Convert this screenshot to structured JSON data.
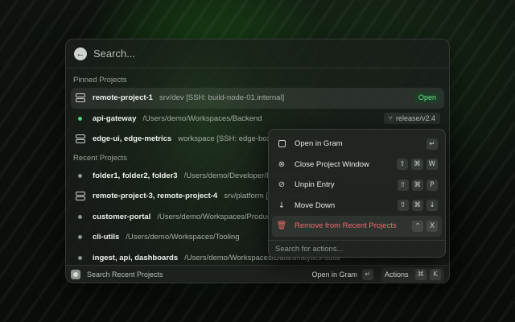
{
  "search": {
    "placeholder": "Search..."
  },
  "sections": {
    "pinned": "Pinned Projects",
    "recent": "Recent Projects"
  },
  "pinned": [
    {
      "icon": "server-icon",
      "name": "remote-project-1",
      "path": "srv/dev [SSH: build-node-01.internal]",
      "badge": "Open"
    },
    {
      "icon": "status-dot-icon",
      "name": "api-gateway",
      "path": "/Users/demo/Workspaces/Backend",
      "branch": "release/v2.4"
    },
    {
      "icon": "server-icon",
      "name": "edge-ui, edge-metrics",
      "path": "workspace [SSH: edge-box-01.local]"
    }
  ],
  "recent": [
    {
      "icon": "dot-icon",
      "name": "folder1, folder2, folder3",
      "path": "/Users/demo/Developer/Playground"
    },
    {
      "icon": "server-icon",
      "name": "remote-project-3, remote-project-4",
      "path": "srv/platform [SSH: platform-02]"
    },
    {
      "icon": "dot-icon",
      "name": "customer-portal",
      "path": "/Users/demo/Workspaces/Product"
    },
    {
      "icon": "dot-icon",
      "name": "cli-utils",
      "path": "/Users/demo/Workspaces/Tooling"
    },
    {
      "icon": "dot-icon",
      "name": "ingest, api, dashboards",
      "path": "/Users/demo/Workspaces/Data/analytics-suite"
    }
  ],
  "footer": {
    "label": "Search Recent Projects",
    "open_label": "Open in Gram",
    "open_key": "↵",
    "actions_label": "Actions",
    "actions_keys": [
      "⌘",
      "K"
    ]
  },
  "popover": {
    "items": [
      {
        "icon": "file-icon",
        "label": "Open in Gram",
        "keys": [
          "↵"
        ]
      },
      {
        "icon": "close-circle-icon",
        "label": "Close Project Window",
        "keys": [
          "⇧",
          "⌘",
          "W"
        ]
      },
      {
        "icon": "unpin-icon",
        "label": "Unpin Entry",
        "keys": [
          "⇧",
          "⌘",
          "P"
        ]
      },
      {
        "icon": "arrow-down-icon",
        "label": "Move Down",
        "keys": [
          "⇧",
          "⌘",
          "↓"
        ]
      },
      {
        "icon": "trash-icon",
        "label": "Remove from Recent Projects",
        "keys": [
          "⌃",
          "X"
        ],
        "danger": true
      }
    ],
    "search_placeholder": "Search for actions..."
  },
  "colors": {
    "accent_green": "#4fd07a",
    "open_badge_bg": "#1d3d26",
    "danger": "#ea6b6b"
  }
}
